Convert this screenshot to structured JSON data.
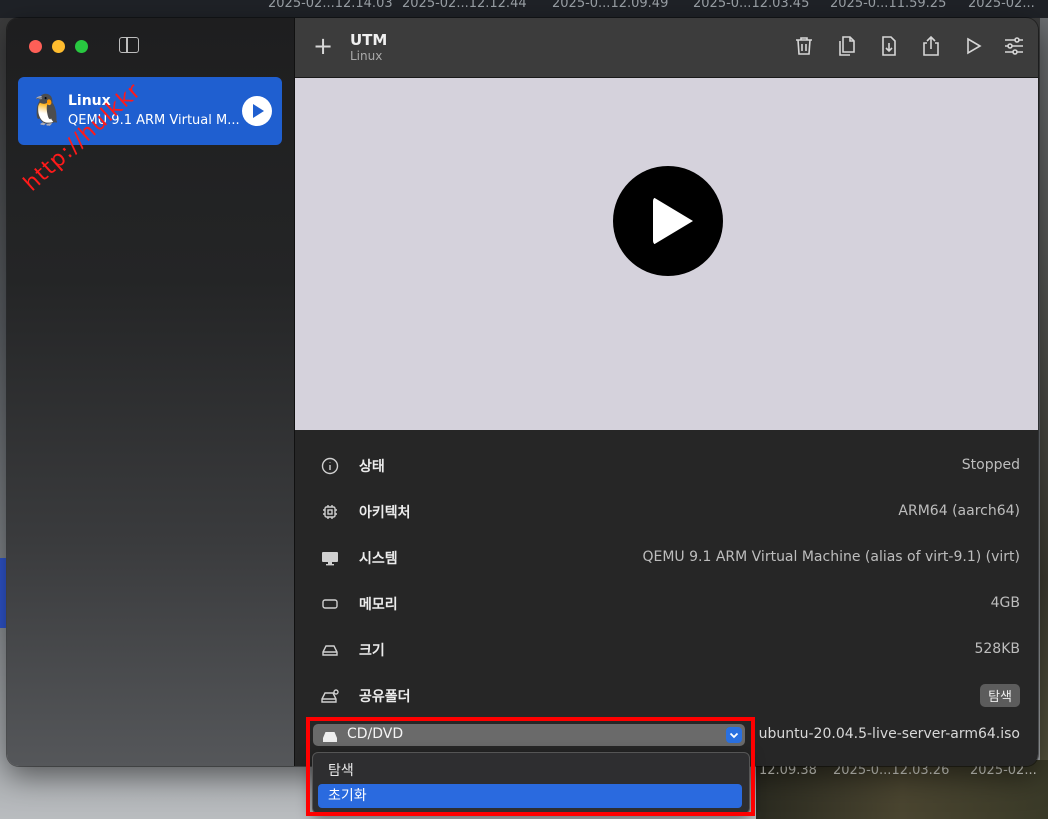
{
  "desktop": {
    "top_items": [
      "2025-02...12.14.03",
      "2025-02...12.12.44",
      "2025-0...12.09.49",
      "2025-0...12.03.45",
      "2025-0...11.59.25",
      "2025-02..."
    ],
    "bottom_items": [
      "12.09.38",
      "2025-0...12.03.26",
      "2025-02..."
    ]
  },
  "sidebar": {
    "watermark": "http://hulkkr",
    "vm": {
      "icon": "tux-penguin-icon",
      "name": "Linux",
      "description": "QEMU 9.1 ARM Virtual M..."
    }
  },
  "toolbar": {
    "add_label": "+",
    "title": "UTM",
    "subtitle": "Linux",
    "icons": [
      "trash-icon",
      "clone-icon",
      "download-icon",
      "share-icon",
      "run-icon",
      "settings-icon"
    ]
  },
  "info": {
    "rows": [
      {
        "icon": "info-circle-icon",
        "label": "상태",
        "value": "Stopped"
      },
      {
        "icon": "cpu-icon",
        "label": "아키텍처",
        "value": "ARM64 (aarch64)"
      },
      {
        "icon": "monitor-icon",
        "label": "시스템",
        "value": "QEMU 9.1 ARM Virtual Machine (alias of virt-9.1) (virt)"
      },
      {
        "icon": "memory-icon",
        "label": "메모리",
        "value": "4GB"
      },
      {
        "icon": "disk-icon",
        "label": "크기",
        "value": "528KB"
      },
      {
        "icon": "shared-folder-icon",
        "label": "공유폴더",
        "value": "탐색"
      }
    ]
  },
  "cd": {
    "label": "CD/DVD",
    "path": "ubuntu-20.04.5-live-server-arm64.iso",
    "options": [
      "탐색",
      "초기화"
    ],
    "selected": "초기화"
  },
  "colors": {
    "accent": "#2a6adf",
    "highlight": "#ff0000",
    "preview_bg": "#d5d2dc"
  }
}
